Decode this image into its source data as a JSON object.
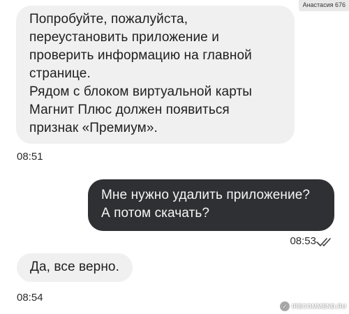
{
  "watermark": {
    "author": "Анастасия 676",
    "site": "IRECOMMEND.RU"
  },
  "messages": [
    {
      "direction": "incoming",
      "lines": [
        "Попробуйте, пожалуйста,",
        "переустановить приложение и",
        "проверить информацию на главной",
        "странице.",
        "Рядом с блоком виртуальной карты",
        "Магнит Плюс должен появиться",
        "признак «Премиум»."
      ],
      "time": "08:51"
    },
    {
      "direction": "outgoing",
      "lines": [
        "Мне нужно удалить приложение?",
        "А потом скачать?"
      ],
      "time": "08:53",
      "status_icon": "double-check-icon"
    },
    {
      "direction": "incoming",
      "lines": [
        "Да, все верно."
      ],
      "time": "08:54"
    }
  ],
  "colors": {
    "incoming_bubble": "#f0f0f0",
    "outgoing_bubble": "#2f3033",
    "background": "#ffffff"
  }
}
